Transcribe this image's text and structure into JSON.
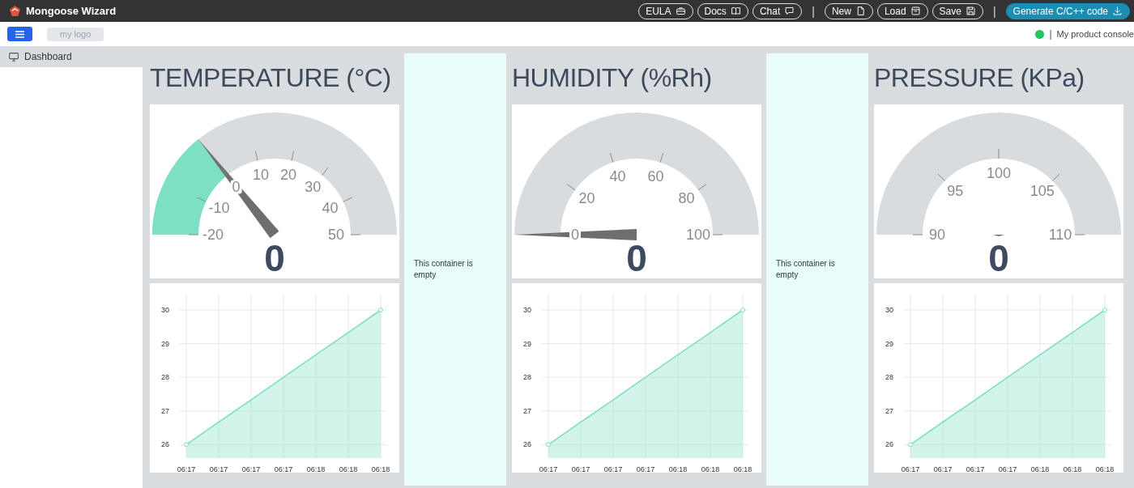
{
  "header": {
    "title": "Mongoose Wizard",
    "separator": "|",
    "button_groups": [
      [
        {
          "label": "EULA",
          "kind": "outline"
        },
        {
          "label": "Docs",
          "kind": "outline"
        },
        {
          "label": "Chat",
          "kind": "outline"
        }
      ],
      [
        {
          "label": "New",
          "kind": "outline"
        },
        {
          "label": "Load",
          "kind": "outline"
        },
        {
          "label": "Save",
          "kind": "outline"
        }
      ],
      [
        {
          "label": "Generate C/C++ code",
          "kind": "primary"
        }
      ]
    ]
  },
  "toolbar": {
    "logo": "my logo",
    "connected": true,
    "separator": "|",
    "console": "My product console"
  },
  "sidebar": {
    "items": [
      {
        "label": "Dashboard",
        "selected": true
      }
    ]
  },
  "panels": [
    {
      "kind": "sensor",
      "title": "TEMPERATURE (°C)",
      "gauge": {
        "ticks": [
          "-20",
          "-10",
          "0",
          "10",
          "20",
          "30",
          "40",
          "50"
        ],
        "value": "0",
        "level": 0.2857
      },
      "chart_data": {
        "type": "area",
        "categories": [
          "06:17",
          "06:17",
          "06:17",
          "06:17",
          "06:18",
          "06:18",
          "06:18"
        ],
        "ylim": [
          25.6,
          30
        ],
        "yticks": [
          26,
          27,
          28,
          29,
          30
        ],
        "grid": true,
        "series": [
          {
            "color": "#7ddfc3",
            "values": [
              26,
              26.67,
              27.33,
              28,
              28.67,
              29.33,
              30
            ]
          }
        ]
      }
    },
    {
      "kind": "empty",
      "text": "This container is empty"
    },
    {
      "kind": "sensor",
      "title": "HUMIDITY (%Rh)",
      "gauge": {
        "ticks": [
          "0",
          "20",
          "40",
          "60",
          "80",
          "100"
        ],
        "value": "0"
      },
      "chart_data": {
        "type": "area",
        "categories": [
          "06:17",
          "06:17",
          "06:17",
          "06:17",
          "06:18",
          "06:18",
          "06:18"
        ],
        "ylim": [
          25.6,
          30
        ],
        "yticks": [
          26,
          27,
          28,
          29,
          30
        ],
        "grid": true,
        "series": [
          {
            "color": "#7ddfc3",
            "values": [
              26,
              26.67,
              27.33,
              28,
              28.67,
              29.33,
              30
            ]
          }
        ]
      }
    },
    {
      "kind": "empty",
      "text": "This container is empty"
    },
    {
      "kind": "sensor",
      "title": "PRESSURE (KPa)",
      "gauge": {
        "ticks": [
          "90",
          "95",
          "100",
          "105",
          "110"
        ],
        "value": "0"
      },
      "chart_data": {
        "type": "area",
        "categories": [
          "06:17",
          "06:17",
          "06:17",
          "06:17",
          "06:18",
          "06:18",
          "06:18"
        ],
        "ylim": [
          25.6,
          30
        ],
        "yticks": [
          26,
          27,
          28,
          29,
          30
        ],
        "grid": true,
        "series": [
          {
            "color": "#7ddfc3",
            "values": [
              26,
              26.67,
              27.33,
              28,
              28.67,
              29.33,
              30
            ]
          }
        ]
      }
    }
  ]
}
